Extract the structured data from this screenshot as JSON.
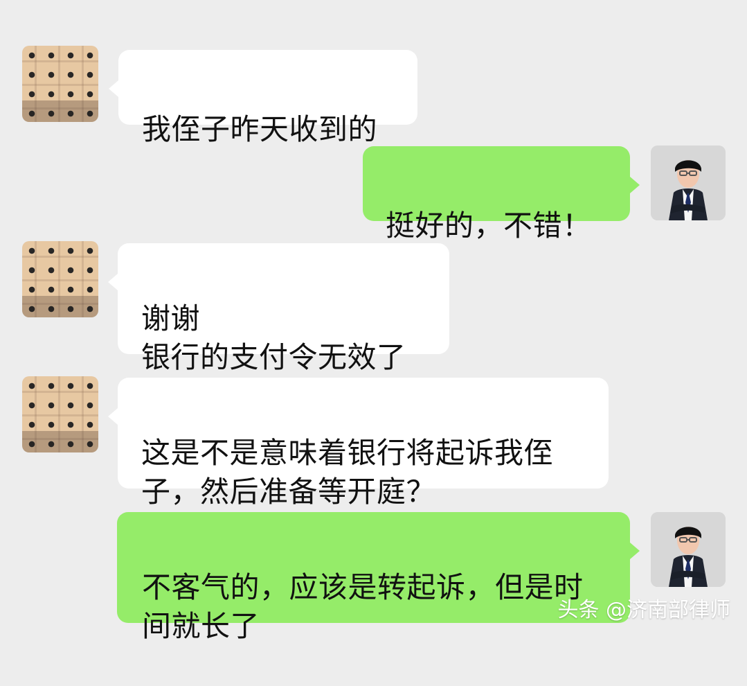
{
  "messages": [
    {
      "side": "left",
      "avatar": "pixelated-avatar",
      "text": "我侄子昨天收到的"
    },
    {
      "side": "right",
      "avatar": "lawyer-avatar",
      "text": "挺好的，不错！"
    },
    {
      "side": "left",
      "avatar": "pixelated-avatar",
      "text": "谢谢\n银行的支付令无效了"
    },
    {
      "side": "left",
      "avatar": "pixelated-avatar",
      "text": "这是不是意味着银行将起诉我侄\n子，然后准备等开庭？"
    },
    {
      "side": "right",
      "avatar": "lawyer-avatar",
      "text": "不客气的，应该是转起诉，但是时\n间就长了"
    }
  ],
  "watermark": "头条 @济南部律师",
  "colors": {
    "background": "#ededed",
    "sent_bubble": "#95ec69",
    "received_bubble": "#ffffff",
    "text": "#111111"
  }
}
